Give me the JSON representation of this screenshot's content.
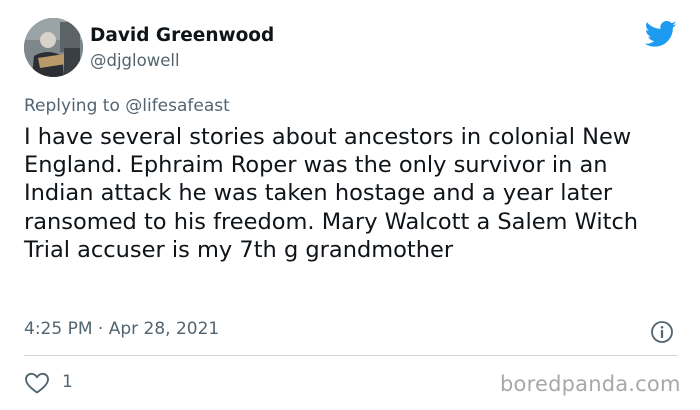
{
  "author": {
    "name": "David Greenwood",
    "handle": "@djglowell"
  },
  "tweet": {
    "reply_prefix": "Replying to",
    "reply_to": "@lifesafeast",
    "text": "I have several stories about ancestors in colonial New England. Ephraim Roper was the only survivor in an Indian attack he was taken hostage and a year later ransomed to his freedom. Mary Walcott a Salem Witch Trial accuser is my 7th g grandmother",
    "timestamp": "4:25 PM · Apr 28, 2021",
    "likes": "1"
  },
  "watermark": "boredpanda.com",
  "icons": {
    "brand": "twitter-bird-icon",
    "info": "info-icon",
    "like": "heart-icon"
  },
  "colors": {
    "twitter_blue": "#1d9bf0",
    "secondary_text": "#536471",
    "primary_text": "#0f1419",
    "divider": "#cfd9de",
    "watermark": "#a8a8a8"
  }
}
